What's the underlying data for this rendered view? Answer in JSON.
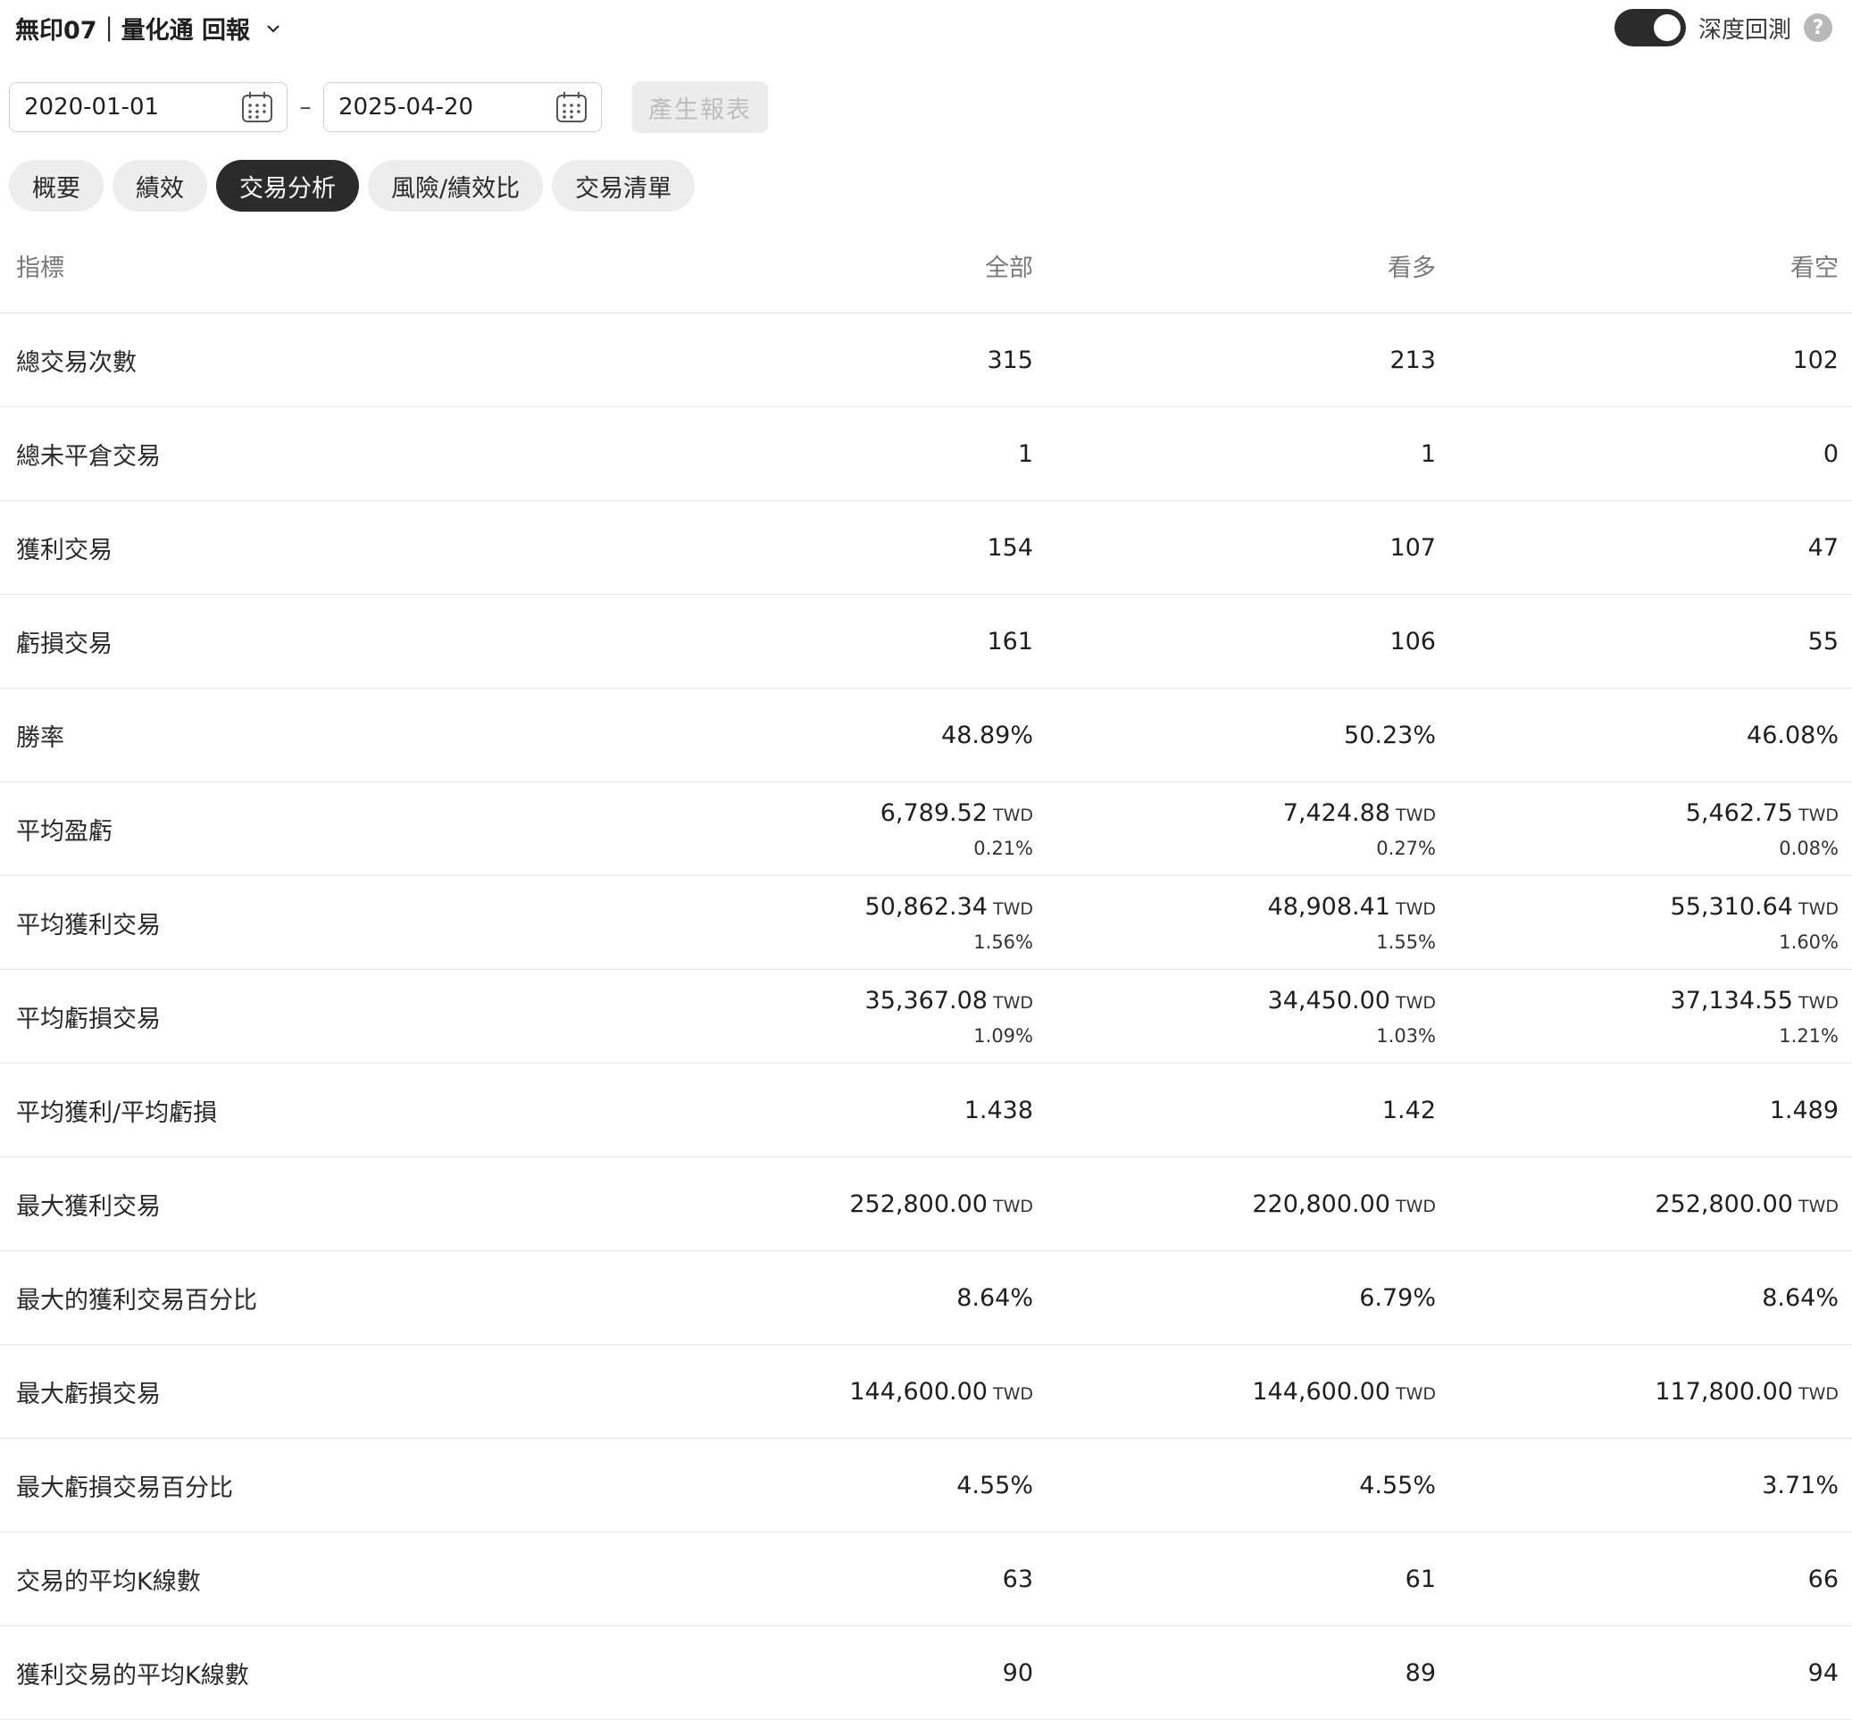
{
  "header": {
    "title": "無印07｜量化通 回報",
    "toggle_label": "深度回測",
    "toggle_on": true,
    "help": "?"
  },
  "dates": {
    "start": "2020-01-01",
    "separator": "–",
    "end": "2025-04-20"
  },
  "generate_label": "產生報表",
  "tabs": [
    "概要",
    "績效",
    "交易分析",
    "風險/績效比",
    "交易清單"
  ],
  "active_tab": "交易分析",
  "table": {
    "columns": [
      "指標",
      "全部",
      "看多",
      "看空"
    ],
    "rows": [
      {
        "label": "總交易次數",
        "cells": [
          {
            "v": "315"
          },
          {
            "v": "213"
          },
          {
            "v": "102"
          }
        ]
      },
      {
        "label": "總未平倉交易",
        "cells": [
          {
            "v": "1"
          },
          {
            "v": "1"
          },
          {
            "v": "0"
          }
        ]
      },
      {
        "label": "獲利交易",
        "cells": [
          {
            "v": "154"
          },
          {
            "v": "107"
          },
          {
            "v": "47"
          }
        ]
      },
      {
        "label": "虧損交易",
        "cells": [
          {
            "v": "161"
          },
          {
            "v": "106"
          },
          {
            "v": "55"
          }
        ]
      },
      {
        "label": "勝率",
        "cells": [
          {
            "v": "48.89%"
          },
          {
            "v": "50.23%"
          },
          {
            "v": "46.08%"
          }
        ]
      },
      {
        "label": "平均盈虧",
        "cells": [
          {
            "v": "6,789.52",
            "u": "TWD",
            "s": "0.21%"
          },
          {
            "v": "7,424.88",
            "u": "TWD",
            "s": "0.27%"
          },
          {
            "v": "5,462.75",
            "u": "TWD",
            "s": "0.08%"
          }
        ]
      },
      {
        "label": "平均獲利交易",
        "cells": [
          {
            "v": "50,862.34",
            "u": "TWD",
            "s": "1.56%"
          },
          {
            "v": "48,908.41",
            "u": "TWD",
            "s": "1.55%"
          },
          {
            "v": "55,310.64",
            "u": "TWD",
            "s": "1.60%"
          }
        ]
      },
      {
        "label": "平均虧損交易",
        "cells": [
          {
            "v": "35,367.08",
            "u": "TWD",
            "s": "1.09%"
          },
          {
            "v": "34,450.00",
            "u": "TWD",
            "s": "1.03%"
          },
          {
            "v": "37,134.55",
            "u": "TWD",
            "s": "1.21%"
          }
        ]
      },
      {
        "label": "平均獲利/平均虧損",
        "cells": [
          {
            "v": "1.438"
          },
          {
            "v": "1.42"
          },
          {
            "v": "1.489"
          }
        ]
      },
      {
        "label": "最大獲利交易",
        "cells": [
          {
            "v": "252,800.00",
            "u": "TWD"
          },
          {
            "v": "220,800.00",
            "u": "TWD"
          },
          {
            "v": "252,800.00",
            "u": "TWD"
          }
        ]
      },
      {
        "label": "最大的獲利交易百分比",
        "cells": [
          {
            "v": "8.64%"
          },
          {
            "v": "6.79%"
          },
          {
            "v": "8.64%"
          }
        ]
      },
      {
        "label": "最大虧損交易",
        "cells": [
          {
            "v": "144,600.00",
            "u": "TWD"
          },
          {
            "v": "144,600.00",
            "u": "TWD"
          },
          {
            "v": "117,800.00",
            "u": "TWD"
          }
        ]
      },
      {
        "label": "最大虧損交易百分比",
        "cells": [
          {
            "v": "4.55%"
          },
          {
            "v": "4.55%"
          },
          {
            "v": "3.71%"
          }
        ]
      },
      {
        "label": "交易的平均K線數",
        "cells": [
          {
            "v": "63"
          },
          {
            "v": "61"
          },
          {
            "v": "66"
          }
        ]
      },
      {
        "label": "獲利交易的平均K線數",
        "cells": [
          {
            "v": "90"
          },
          {
            "v": "89"
          },
          {
            "v": "94"
          }
        ]
      }
    ]
  }
}
